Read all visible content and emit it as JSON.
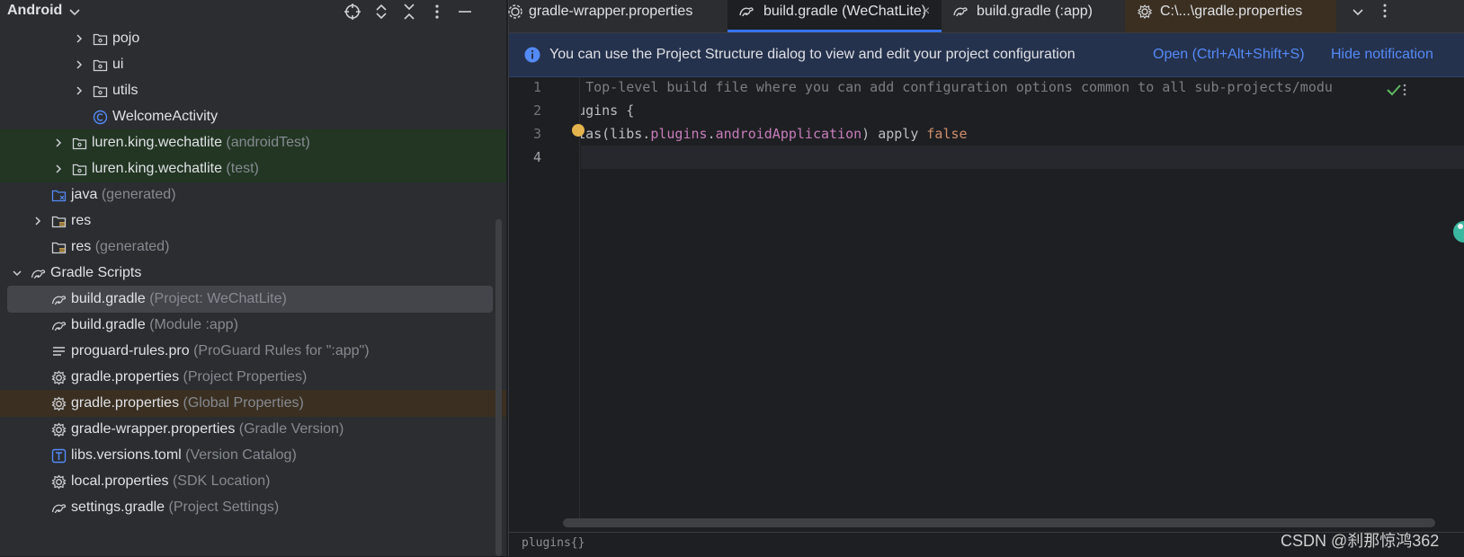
{
  "project_panel": {
    "title": "Android",
    "tree": [
      {
        "label": "pojo",
        "hint": "",
        "icon": "package-folder-icon",
        "chevron": "right",
        "indent": 3
      },
      {
        "label": "ui",
        "hint": "",
        "icon": "package-folder-icon",
        "chevron": "right",
        "indent": 3
      },
      {
        "label": "utils",
        "hint": "",
        "icon": "package-folder-icon",
        "chevron": "right",
        "indent": 3
      },
      {
        "label": "WelcomeActivity",
        "hint": "",
        "icon": "class-icon",
        "chevron": "",
        "indent": 3
      },
      {
        "label": "luren.king.wechatlite",
        "hint": "(androidTest)",
        "icon": "package-folder-icon",
        "chevron": "right",
        "indent": 2,
        "highlight": "green"
      },
      {
        "label": "luren.king.wechatlite",
        "hint": "(test)",
        "icon": "package-folder-icon",
        "chevron": "right",
        "indent": 2,
        "highlight": "green"
      },
      {
        "label": "java",
        "hint": "(generated)",
        "icon": "generated-source-folder-icon",
        "chevron": "",
        "indent": 1
      },
      {
        "label": "res",
        "hint": "",
        "icon": "resource-folder-icon",
        "chevron": "right",
        "indent": 1
      },
      {
        "label": "res",
        "hint": "(generated)",
        "icon": "resource-folder-icon",
        "chevron": "",
        "indent": 1
      },
      {
        "label": "Gradle Scripts",
        "hint": "",
        "icon": "gradle-icon",
        "chevron": "down",
        "indent": 0
      },
      {
        "label": "build.gradle",
        "hint": "(Project: WeChatLite)",
        "icon": "gradle-icon",
        "chevron": "",
        "indent": 1,
        "highlight": "selected"
      },
      {
        "label": "build.gradle",
        "hint": "(Module :app)",
        "icon": "gradle-icon",
        "chevron": "",
        "indent": 1
      },
      {
        "label": "proguard-rules.pro",
        "hint": "(ProGuard Rules for \":app\")",
        "icon": "text-file-icon",
        "chevron": "",
        "indent": 1
      },
      {
        "label": "gradle.properties",
        "hint": "(Project Properties)",
        "icon": "gear-icon",
        "chevron": "",
        "indent": 1
      },
      {
        "label": "gradle.properties",
        "hint": "(Global Properties)",
        "icon": "gear-icon",
        "chevron": "",
        "indent": 1,
        "highlight": "orange"
      },
      {
        "label": "gradle-wrapper.properties",
        "hint": "(Gradle Version)",
        "icon": "gear-icon",
        "chevron": "",
        "indent": 1
      },
      {
        "label": "libs.versions.toml",
        "hint": "(Version Catalog)",
        "icon": "toml-file-icon",
        "chevron": "",
        "indent": 1
      },
      {
        "label": "local.properties",
        "hint": "(SDK Location)",
        "icon": "gear-icon",
        "chevron": "",
        "indent": 1
      },
      {
        "label": "settings.gradle",
        "hint": "(Project Settings)",
        "icon": "gradle-icon",
        "chevron": "",
        "indent": 1
      }
    ]
  },
  "tabs": [
    {
      "label": "gradle-wrapper.properties",
      "icon": "gear-icon",
      "active": false
    },
    {
      "label": "build.gradle (WeChatLite)",
      "icon": "gradle-icon",
      "active": true,
      "close_label": "×"
    },
    {
      "label": "build.gradle (:app)",
      "icon": "gradle-icon",
      "active": false
    },
    {
      "label": "C:\\...\\gradle.properties",
      "icon": "gear-icon",
      "active": false
    }
  ],
  "notification": {
    "text": "You can use the Project Structure dialog to view and edit your project configuration",
    "open_link": "Open (Ctrl+Alt+Shift+S)",
    "hide_link": "Hide notification"
  },
  "editor": {
    "line_numbers": [
      "1",
      "2",
      "3",
      "4"
    ],
    "current_line": 4,
    "code": {
      "line1": "// Top-level build file where you can add configuration options common to all sub-projects/modu",
      "line2_a": "plugins ",
      "line2_b": "{",
      "line3_a": "alias(libs.",
      "line3_b": "plugins",
      "line3_c": ".",
      "line3_d": "androidApplication",
      "line3_e": ") apply ",
      "line3_f": "false",
      "line4": "}"
    },
    "breadcrumb": "plugins{}"
  },
  "watermark": "CSDN @刹那惊鸿362",
  "colors": {
    "accent": "#3574f0",
    "link": "#548af7",
    "keyword": "#cf8e6d",
    "property": "#c77dbb",
    "comment": "#7a7e85"
  }
}
